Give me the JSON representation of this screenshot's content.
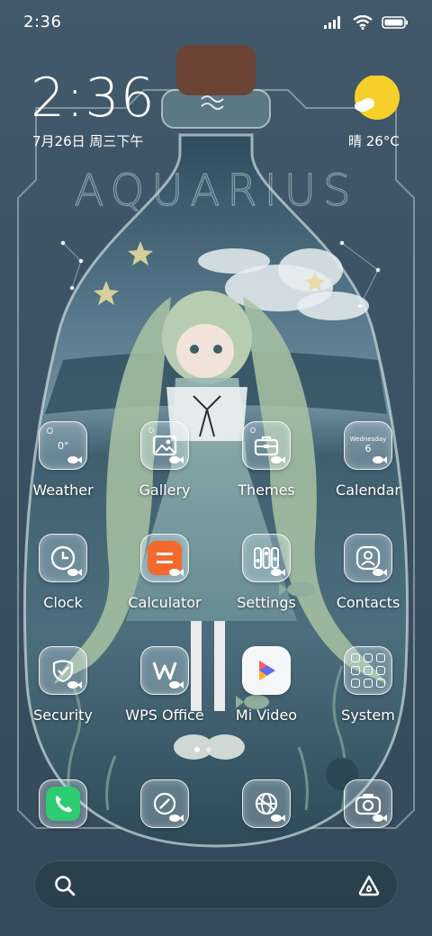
{
  "status_bar": {
    "time": "2:36",
    "icons": [
      "signal-icon",
      "wifi-icon",
      "battery-icon"
    ]
  },
  "clock_widget": {
    "time": "2:36",
    "date": "7月26日 周三下午",
    "weather": "晴 26°C",
    "weather_icon": "sunny-icon"
  },
  "wallpaper": {
    "title": "AQUARIUS",
    "accent": "#f4c430",
    "background": "#3d5563"
  },
  "apps": [
    {
      "label": "Weather",
      "icon": "weather-icon",
      "widget_text": "0°"
    },
    {
      "label": "Gallery",
      "icon": "gallery-icon"
    },
    {
      "label": "Themes",
      "icon": "themes-icon"
    },
    {
      "label": "Calendar",
      "icon": "calendar-icon",
      "widget_day": "Wednesday",
      "widget_date": "6"
    },
    {
      "label": "Clock",
      "icon": "clock-icon"
    },
    {
      "label": "Calculator",
      "icon": "calculator-icon",
      "color": "#f26a2e"
    },
    {
      "label": "Settings",
      "icon": "settings-icon"
    },
    {
      "label": "Contacts",
      "icon": "contacts-icon"
    },
    {
      "label": "Security",
      "icon": "security-icon"
    },
    {
      "label": "WPS Office",
      "icon": "wps-office-icon"
    },
    {
      "label": "Mi Video",
      "icon": "mi-video-icon"
    },
    {
      "label": "System",
      "icon": "system-folder-icon"
    }
  ],
  "dock": [
    {
      "icon": "phone-icon",
      "color": "#2ecc71"
    },
    {
      "icon": "notes-icon"
    },
    {
      "icon": "browser-icon"
    },
    {
      "icon": "camera-icon"
    }
  ],
  "page_indicator": {
    "count": 2,
    "active": 1
  },
  "search_bar": {
    "icons": [
      "search-icon",
      "assistant-icon"
    ]
  }
}
